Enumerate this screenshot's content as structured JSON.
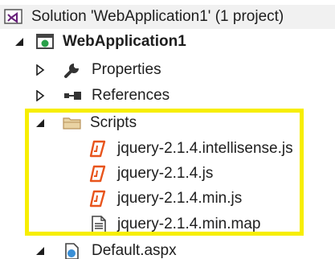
{
  "solution_explorer": {
    "solution": {
      "label": "Solution 'WebApplication1' (1 project)",
      "icon": "vs-solution-icon"
    },
    "project": {
      "label": "WebApplication1",
      "icon": "web-project-icon",
      "expanded": true
    },
    "nodes": [
      {
        "label": "Properties",
        "icon": "wrench-icon",
        "expanded": false
      },
      {
        "label": "References",
        "icon": "references-icon",
        "expanded": false
      },
      {
        "label": "Scripts",
        "icon": "folder-icon",
        "expanded": true
      },
      {
        "label": "jquery-2.1.4.intellisense.js",
        "icon": "js-file-icon"
      },
      {
        "label": "jquery-2.1.4.js",
        "icon": "js-file-icon"
      },
      {
        "label": "jquery-2.1.4.min.js",
        "icon": "js-file-icon"
      },
      {
        "label": "jquery-2.1.4.min.map",
        "icon": "map-file-icon"
      },
      {
        "label": "Default.aspx",
        "icon": "aspx-file-icon",
        "expanded": true
      }
    ]
  },
  "colors": {
    "highlight_border": "#f7ee00",
    "js_icon": "#e8541c",
    "folder": "#dcb67a",
    "solution_icon": "#68217a"
  }
}
